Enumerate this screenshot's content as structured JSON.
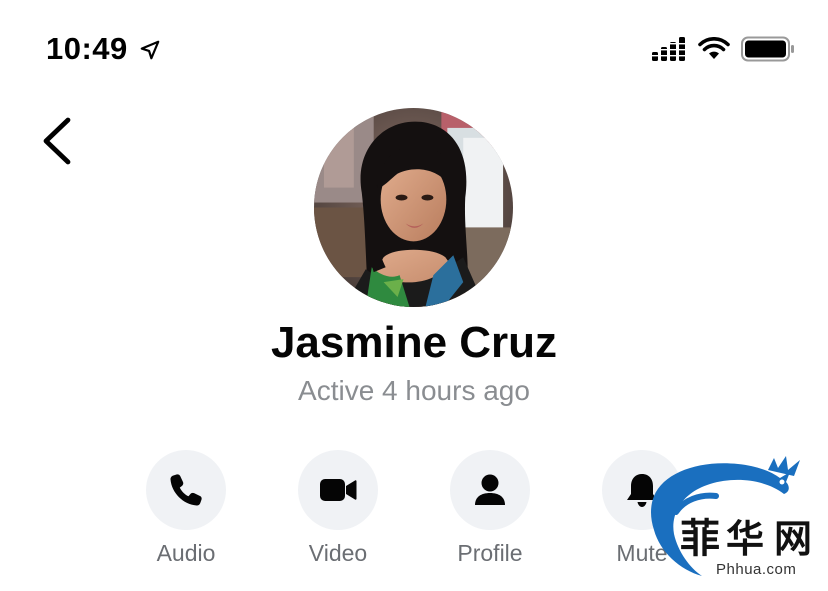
{
  "status_bar": {
    "time": "10:49",
    "icons": [
      "location-arrow-icon",
      "cellular-signal-icon",
      "wifi-icon",
      "battery-icon"
    ]
  },
  "navigation": {
    "back_icon": "chevron-left-icon"
  },
  "contact": {
    "name": "Jasmine Cruz",
    "status": "Active 4 hours ago"
  },
  "actions": [
    {
      "label": "Audio",
      "icon": "phone-icon"
    },
    {
      "label": "Video",
      "icon": "video-camera-icon"
    },
    {
      "label": "Profile",
      "icon": "person-icon"
    },
    {
      "label": "Mute",
      "icon": "bell-icon"
    }
  ],
  "watermark": {
    "text": "Phhua.com"
  },
  "colors": {
    "action_background": "#f0f2f5",
    "secondary_text": "#8a8d91",
    "watermark_blue": "#1a6fbf"
  }
}
